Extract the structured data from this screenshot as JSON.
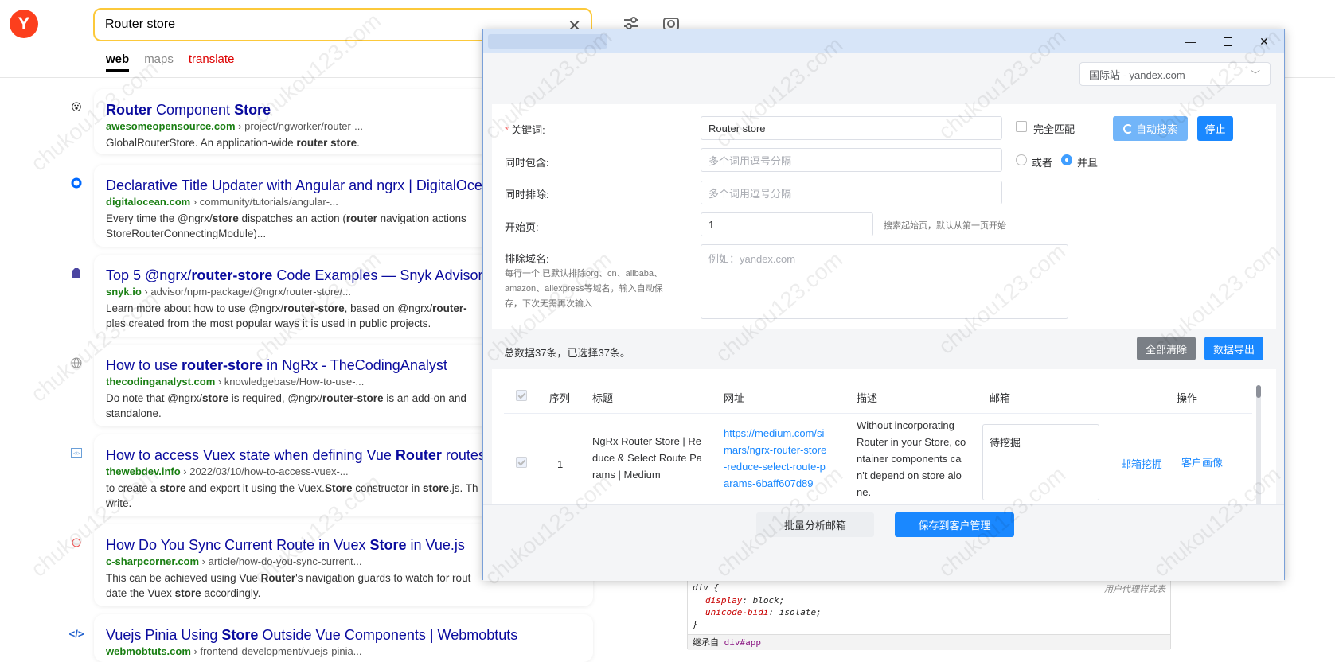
{
  "search": {
    "logo_letter": "Y",
    "query": "Router store",
    "tabs": [
      "web",
      "maps",
      "translate"
    ]
  },
  "results": [
    {
      "title_pre": "",
      "title_b1": "Router",
      "title_mid": " Component ",
      "title_b2": "Store",
      "title_post": "",
      "domain": "awesomeopensource.com",
      "path": " › project/ngworker/router-...",
      "snippet": "GlobalRouterStore. An application-wide <b>router store</b>."
    },
    {
      "title_pre": "Declarative Title Updater with Angular and ngrx | DigitalOce",
      "title_b1": "",
      "title_mid": "",
      "title_b2": "",
      "title_post": "",
      "domain": "digitalocean.com",
      "path": " › community/tutorials/angular-...",
      "snippet": "Every time the @ngrx/<b>store</b> dispatches an action (<b>router</b> navigation actions StoreRouterConnectingModule)..."
    },
    {
      "title_pre": "Top 5 @ngrx/",
      "title_b1": "router-store",
      "title_mid": " Code Examples — Snyk Advisor",
      "title_b2": "",
      "title_post": "",
      "domain": "snyk.io",
      "path": " › advisor/npm-package/@ngrx/router-store/...",
      "snippet": "Learn more about how to use @ngrx/<b>router-store</b>, based on @ngrx/<b>router-</b> ples created from the most popular ways it is used in public projects."
    },
    {
      "title_pre": "How to use ",
      "title_b1": "router-store",
      "title_mid": " in NgRx - TheCodingAnalyst",
      "title_b2": "",
      "title_post": "",
      "domain": "thecodinganalyst.com",
      "path": " › knowledgebase/How-to-use-...",
      "snippet": "Do note that @ngrx/<b>store</b> is required, @ngrx/<b>router-store</b> is an add-on and standalone."
    },
    {
      "title_pre": "How to access Vuex state when defining Vue ",
      "title_b1": "Router",
      "title_mid": " routes",
      "title_b2": "",
      "title_post": "",
      "domain": "thewebdev.info",
      "path": " › 2022/03/10/how-to-access-vuex-...",
      "snippet": "to create a <b>store</b> and export it using the Vuex.<b>Store</b> constructor in <b>store</b>.js. Th write."
    },
    {
      "title_pre": "How Do You Sync Current Route in Vuex ",
      "title_b1": "Store",
      "title_mid": " in Vue.js",
      "title_b2": "",
      "title_post": "",
      "domain": "c-sharpcorner.com",
      "path": " › article/how-do-you-sync-current...",
      "snippet": "This can be achieved using Vue <b>Router</b>'s navigation guards to watch for rout date the Vuex <b>store</b> accordingly."
    },
    {
      "title_pre": "Vuejs Pinia Using ",
      "title_b1": "Store",
      "title_mid": " Outside Vue Components | Webmobtuts",
      "title_b2": "",
      "title_post": "",
      "domain": "webmobtuts.com",
      "path": " › frontend-development/vuejs-pinia...",
      "snippet": ""
    }
  ],
  "devtools": {
    "selector": "div {",
    "origin": "用户代理样式表",
    "prop1": "display",
    "val1": "block;",
    "prop2": "unicode-bidi",
    "val2": "isolate;",
    "close": "}",
    "inherit_label": "继承自",
    "inherit_target": "div#app"
  },
  "dialog": {
    "region": "国际站 - yandex.com",
    "labels": {
      "keyword": "关键词:",
      "include": "同时包含:",
      "exclude": "同时排除:",
      "start_page": "开始页:",
      "exclude_domain": "排除域名:"
    },
    "keyword_value": "Router store",
    "include_placeholder": "多个词用逗号分隔",
    "exclude_placeholder": "多个词用逗号分隔",
    "start_page_value": "1",
    "start_page_hint": "搜索起始页，默认从第一页开始",
    "domain_placeholder": "例如：yandex.com",
    "domain_hint": [
      "每行一个,已默认排除org、cn、alibaba、",
      "amazon、aliexpress等域名，输入自动保",
      "存，下次无需再次输入"
    ],
    "exact_match": "完全匹配",
    "or_label": "或者",
    "and_label": "并且",
    "auto_search": "自动搜索",
    "stop": "停止",
    "stats": "总数据37条，已选择37条。",
    "clear_all": "全部清除",
    "export": "数据导出",
    "columns": [
      "序列",
      "标题",
      "网址",
      "描述",
      "邮箱",
      "操作"
    ],
    "rows": [
      {
        "index": "1",
        "title": [
          "NgRx Router Store | Re",
          "duce & Select Route Pa",
          "rams | Medium"
        ],
        "url": [
          "https://medium.com/si",
          "mars/ngrx-router-store",
          "-reduce-select-route-p",
          "arams-6baff607d89"
        ],
        "desc": [
          "Without incorporating",
          "Router in your Store, co",
          "ntainer components ca",
          "n't depend on store alo",
          "ne."
        ],
        "email": "待挖掘",
        "action1": "邮箱挖掘",
        "action2": "客户画像"
      }
    ],
    "batch_analyze": "批量分析邮箱",
    "save_to_client": "保存到客户管理"
  },
  "watermark": "chukou123.com"
}
